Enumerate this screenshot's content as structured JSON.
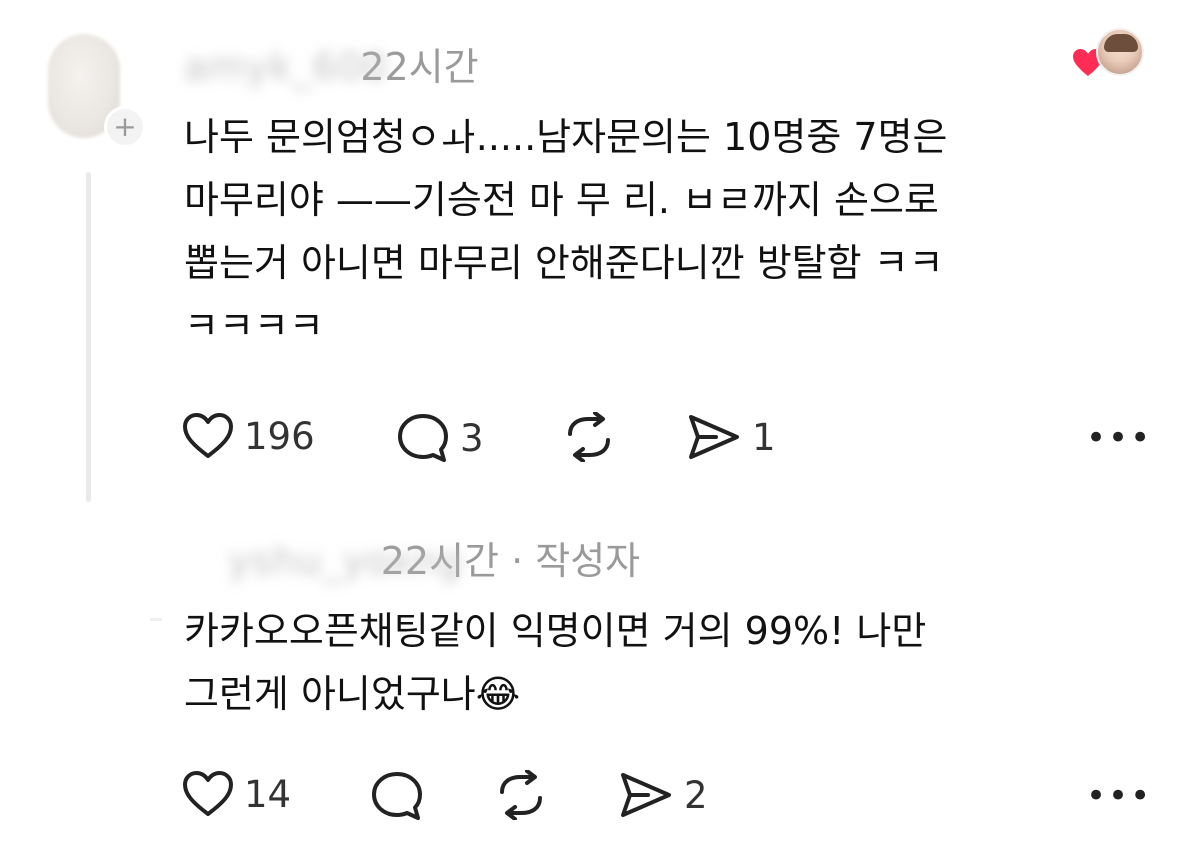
{
  "posts": [
    {
      "username": "amyk_600",
      "time": "22시간",
      "body_lines": [
        "나두 문의엄청ㅇㅘ.....남자문의는 10명중 7명은",
        "마무리야 ——기승전 마 무 리. ㅂㄹ까지 손으로",
        "뽑는거 아니면 마무리 안해준다니깐 방탈함 ㅋㅋ",
        "ㅋㅋㅋㅋ"
      ],
      "likes": "196",
      "replies": "3",
      "reposts": "",
      "shares": "1"
    },
    {
      "username": "yshu_yoxng",
      "time": "22시간 · 작성자",
      "body_lines": [
        "카카오오픈채팅같이 익명이면 거의 99%! 나만",
        "그런게 아니었구나😂"
      ],
      "likes": "14",
      "replies": "",
      "reposts": "",
      "shares": "2"
    }
  ],
  "icons": {
    "like": "heart-outline-icon",
    "reply": "speech-bubble-icon",
    "repost": "repost-arrows-icon",
    "share": "send-icon",
    "more": "more-dots-icon",
    "liked_badge": "heart-filled-icon"
  },
  "colors": {
    "text": "#111111",
    "muted": "#9a9a9a",
    "heart": "#ff2d55",
    "thread_line": "#e9e9e9"
  },
  "more_label": "•••"
}
